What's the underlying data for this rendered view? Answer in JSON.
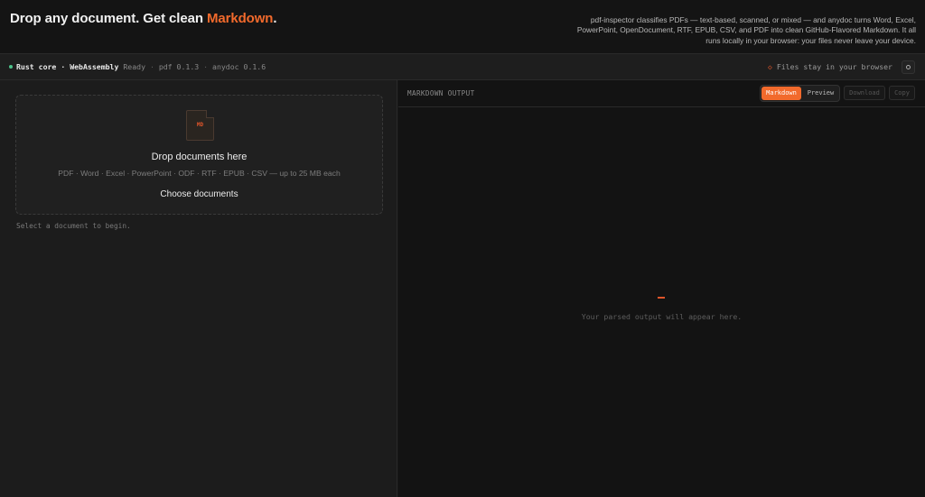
{
  "hero": {
    "title_prefix": "Drop any document. Get clean ",
    "title_accent": "Markdown",
    "title_suffix": ".",
    "description": "pdf-inspector classifies PDFs — text-based, scanned, or mixed — and anydoc turns Word, Excel, PowerPoint, OpenDocument, RTF, EPUB, CSV, and PDF into clean GitHub-Flavored Markdown. It all runs locally in your browser: your files never leave your device."
  },
  "status": {
    "core_label": "Rust core",
    "separator": "·",
    "engine_label": "WebAssembly",
    "state": "Ready",
    "pdf_version": "pdf 0.1.3",
    "anydoc_version": "anydoc 0.1.6",
    "privacy_note": "Files stay in your browser",
    "status_color": "#4cc38a"
  },
  "dropzone": {
    "file_icon_label": "MD",
    "title": "Drop documents here",
    "formats": "PDF · Word · Excel · PowerPoint · ODF · RTF · EPUB · CSV — up to 25 MB each",
    "button_label": "Choose documents",
    "hint": "Select a document to begin."
  },
  "output": {
    "panel_label": "MARKDOWN OUTPUT",
    "tab_markdown": "Markdown",
    "tab_preview": "Preview",
    "active_tab": "Markdown",
    "download_label": "Download",
    "copy_label": "Copy",
    "empty_text": "Your parsed output will appear here."
  },
  "colors": {
    "accent": "#f26a2c",
    "background": "#161616"
  }
}
